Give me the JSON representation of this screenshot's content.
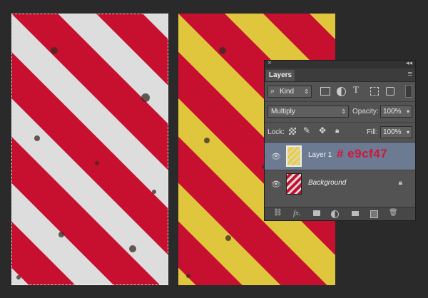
{
  "layers_panel": {
    "close_glyph": "×",
    "collapse_glyph": "◂◂",
    "tab_label": "Layers",
    "menu_glyph": "≡",
    "filter": {
      "search_glyph": "⌕",
      "value": "Kind"
    },
    "filter_icons": [
      "image-filter-icon",
      "adjustment-filter-icon",
      "type-filter-icon",
      "shape-filter-icon",
      "smart-object-filter-icon"
    ],
    "blend_mode": "Multiply",
    "opacity_label": "Opacity:",
    "opacity_value": "100%",
    "lock_label": "Lock:",
    "fill_label": "Fill:",
    "fill_value": "100%",
    "layers": [
      {
        "name": "Layer 1",
        "selected": true,
        "annotation": "# e9cf47"
      },
      {
        "name": "Background",
        "selected": false
      }
    ],
    "bottom_icons": [
      "link-icon",
      "fx-icon",
      "mask-icon",
      "adjustment-icon",
      "group-icon",
      "new-layer-icon",
      "trash-icon"
    ],
    "fx_label": "fx."
  },
  "colors": {
    "stripe_red": "#c7102f",
    "stripe_white": "#dddddd",
    "stripe_yellow": "#e9cf47",
    "annotation_red": "#d11640",
    "panel_bg": "#535353"
  }
}
